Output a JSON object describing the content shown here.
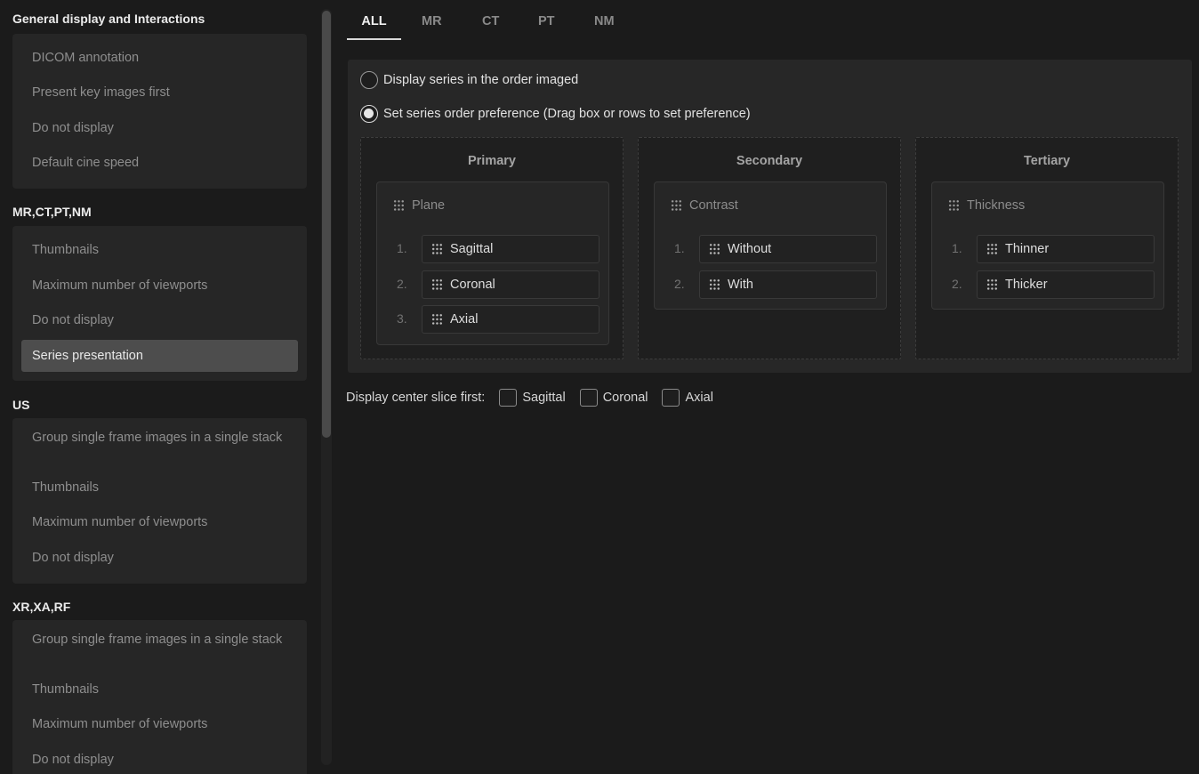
{
  "sidebar": {
    "sections": [
      {
        "title": "General display and Interactions",
        "items": [
          "DICOM annotation",
          "Present key images first",
          "Do not display",
          "Default cine speed"
        ]
      },
      {
        "title": "MR,CT,PT,NM",
        "items": [
          "Thumbnails",
          "Maximum number of viewports",
          "Do not display",
          "Series presentation"
        ]
      },
      {
        "title": "US",
        "items": [
          "Group single frame images in a single stack",
          "Thumbnails",
          "Maximum number of viewports",
          "Do not display"
        ]
      },
      {
        "title": "XR,XA,RF",
        "items": [
          "Group single frame images in a single stack",
          "Thumbnails",
          "Maximum number of viewports",
          "Do not display"
        ]
      }
    ],
    "active_item": "Series presentation"
  },
  "tabs": [
    "ALL",
    "MR",
    "CT",
    "PT",
    "NM"
  ],
  "active_tab": "ALL",
  "series_order": {
    "option_imaged": "Display series in the order imaged",
    "option_preference": "Set series order preference (Drag box or rows to set preference)",
    "selected": "preference",
    "priorities": [
      {
        "title": "Primary",
        "group": "Plane",
        "rows": [
          {
            "num": "1.",
            "label": "Sagittal"
          },
          {
            "num": "2.",
            "label": "Coronal"
          },
          {
            "num": "3.",
            "label": "Axial"
          }
        ]
      },
      {
        "title": "Secondary",
        "group": "Contrast",
        "rows": [
          {
            "num": "1.",
            "label": "Without"
          },
          {
            "num": "2.",
            "label": "With"
          }
        ]
      },
      {
        "title": "Tertiary",
        "group": "Thickness",
        "rows": [
          {
            "num": "1.",
            "label": "Thinner"
          },
          {
            "num": "2.",
            "label": "Thicker"
          }
        ]
      }
    ]
  },
  "center_slice": {
    "label": "Display center slice first:",
    "options": [
      {
        "label": "Sagittal",
        "checked": false
      },
      {
        "label": "Coronal",
        "checked": false
      },
      {
        "label": "Axial",
        "checked": false
      }
    ]
  },
  "colors": {
    "background": "#1b1b1b",
    "panel": "#272727",
    "active_item": "#4d4d4d"
  }
}
